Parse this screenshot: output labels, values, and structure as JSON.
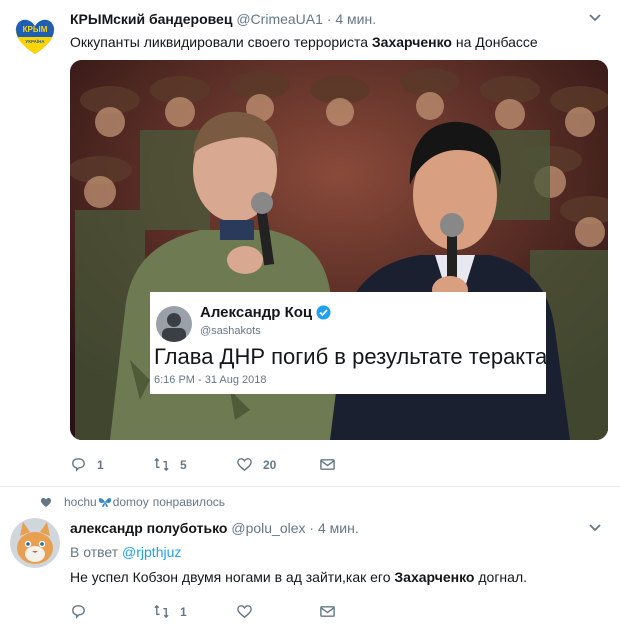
{
  "tweet1": {
    "name": "КРЫМский бандеровец",
    "handle": "@CrimeaUA1",
    "dot": "·",
    "time": "4 мин.",
    "avatar_text_top": "КРЫМ",
    "avatar_text_bottom": "УКРАЇНА",
    "text_before": "Оккупанты ликвидировали своего террориста ",
    "text_bold": "Захарченко",
    "text_after": " на Донбассе",
    "embedded": {
      "name": "Александр Коц",
      "handle": "@sashakots",
      "text": "Глава ДНР погиб в результате теракта",
      "time": "6:16 PM - 31 Aug 2018"
    },
    "actions": {
      "reply": "1",
      "retweet": "5",
      "like": "20"
    }
  },
  "social_context": {
    "user": "hochu",
    "user2": "domoy",
    "action": "понравилось"
  },
  "tweet2": {
    "name": "александр полуботько",
    "handle": "@polu_olex",
    "dot": "·",
    "time": "4 мин.",
    "reply_prefix": "В ответ ",
    "reply_to": "@rjpthjuz",
    "text_before": "Не успел Кобзон двумя ногами в ад зайти,как его ",
    "text_bold": "Захарченко",
    "text_after": " догнал.",
    "actions": {
      "reply": "",
      "retweet": "1",
      "like": ""
    }
  },
  "colors": {
    "accent": "#1da1f2",
    "muted": "#657786",
    "text": "#14171a"
  }
}
